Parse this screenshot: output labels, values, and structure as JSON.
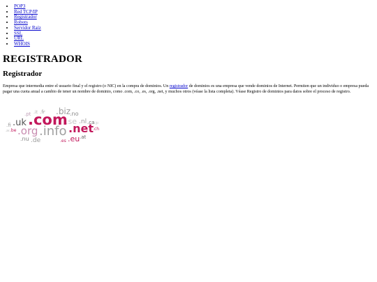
{
  "nav": {
    "items": [
      {
        "label": "POP3"
      },
      {
        "label": "Red TCP/IP"
      },
      {
        "label": "Registrador"
      },
      {
        "label": "Robots"
      },
      {
        "label": "Servidor Raíz"
      },
      {
        "label": "SSL"
      },
      {
        "label": "URL"
      },
      {
        "label": "WHOIS"
      }
    ]
  },
  "page": {
    "title": "REGISTRADOR",
    "subtitle": "Registrador",
    "para_before_link": "Empresa que intermedia entre el usuario final y el registro (o NIC) en la compra de dominios. Un ",
    "para_link": "registrador",
    "para_after_link": " de dominios es una empresa que vende dominios de Internet. Permiten que un individuo o empresa pueda pagar una cuota anual a cambio de tener un nombre de dominio, como .com, .co, .es, .org, .net, y muchos otros (véase la lista completa). Véase Registro de dominios para datos sobre el proceso de registro."
  },
  "tld_cloud": {
    "words": [
      {
        "text": ".pt",
        "color": "#c0a0b8"
      },
      {
        "text": ".it",
        "color": "#b0b0b0"
      },
      {
        "text": ".fr",
        "color": "#9a9a9a"
      },
      {
        "text": ".biz",
        "color": "#9a9a9a"
      },
      {
        "text": ".no",
        "color": "#888888"
      },
      {
        "text": ".uk",
        "color": "#555555"
      },
      {
        "text": ".com",
        "color": "#c2185b"
      },
      {
        "text": ".se",
        "color": "#c8c8c8"
      },
      {
        "text": ".nl",
        "color": "#9a9a9a"
      },
      {
        "text": ".ca",
        "color": "#666666"
      },
      {
        "text": ".fi",
        "color": "#9a9a9a"
      },
      {
        "text": ".ch",
        "color": "#c2185b"
      },
      {
        "text": ".be",
        "color": "#c2185b"
      },
      {
        "text": ".org",
        "color": "#c88cb0"
      },
      {
        "text": ".info",
        "color": "#a0a0a0"
      },
      {
        "text": ".net",
        "color": "#c2185b"
      },
      {
        "text": ".nu",
        "color": "#888888"
      },
      {
        "text": ".de",
        "color": "#9a9a9a"
      },
      {
        "text": ".es",
        "color": "#c2185b"
      },
      {
        "text": ".eu",
        "color": "#c2185b"
      },
      {
        "text": ".at",
        "color": "#666666"
      },
      {
        "text": ".jp",
        "color": "#cccccc"
      },
      {
        "text": ".ar",
        "color": "#aaaaaa"
      }
    ]
  }
}
